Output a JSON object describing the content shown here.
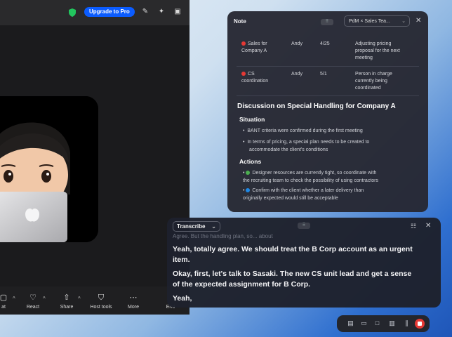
{
  "meeting": {
    "upgrade_label": "Upgrade to Pro",
    "top_icons": [
      "shield-icon",
      "pencil-icon",
      "sparkle-icon",
      "window-icon"
    ],
    "toolbar": [
      {
        "label": "at",
        "icon": "grid-icon"
      },
      {
        "label": "React",
        "icon": "heart-icon"
      },
      {
        "label": "Share",
        "icon": "share-icon"
      },
      {
        "label": "Host tools",
        "icon": "shield-icon"
      },
      {
        "label": "More",
        "icon": "more-icon"
      },
      {
        "label": "End",
        "icon": ""
      }
    ]
  },
  "note": {
    "title": "Note",
    "select_value": "PdM × Sales Tea...",
    "rows": [
      {
        "topic_lines": [
          "Sales for",
          "Company A"
        ],
        "owner": "Andy",
        "date": "4/25",
        "detail_lines": [
          "Adjusting pricing",
          "proposal for the next",
          "meeting"
        ],
        "dot_color": "#e53935"
      },
      {
        "topic_lines": [
          "CS",
          "coordination"
        ],
        "owner": "Andy",
        "date": "5/1",
        "detail_lines": [
          "Person in charge",
          "currently being",
          "coordinated"
        ],
        "dot_color": "#e53935"
      }
    ],
    "heading": "Discussion on Special Handling for Company A",
    "situation_title": "Situation",
    "situation_bullets": [
      [
        "BANT criteria were confirmed during the first meeting"
      ],
      [
        "In terms of pricing, a special plan needs to be created to",
        "accommodate the client's conditions"
      ]
    ],
    "actions_title": "Actions",
    "actions_bullets": [
      {
        "lines": [
          "Designer resources are currently tight, so coordinate with",
          "the recruiting team to check the possibility of using contractors"
        ],
        "dot_color": "#4caf50"
      },
      {
        "lines": [
          "Confirm with the client whether a later delivery than",
          "originally expected would still be acceptable"
        ],
        "dot_color": "#1e88e5"
      }
    ]
  },
  "transcribe": {
    "select_label": "Transcribe",
    "faded_line": "Agree. But the handling plan, so... about",
    "lines": [
      [
        "Yeah, totally agree. We should treat the B Corp account as an urgent",
        "item."
      ],
      [
        "Okay, first, let's talk to Sasaki. The new CS unit lead and get a sense",
        "of the expected assignment for B Corp."
      ],
      [
        "Yeah,"
      ]
    ]
  },
  "colors": {
    "accent": "#0b5cff",
    "record": "#e53935",
    "panel": "#26283a"
  }
}
